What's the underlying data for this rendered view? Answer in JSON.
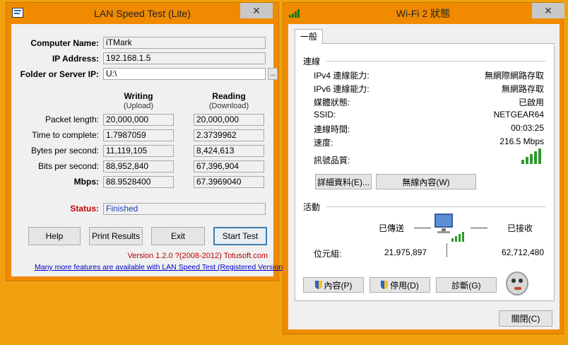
{
  "lan": {
    "title": "LAN Speed Test (Lite)",
    "close": "✕",
    "computer_name_label": "Computer Name:",
    "computer_name": "iTMark",
    "ip_label": "IP Address:",
    "ip": "192.168.1.5",
    "folder_label": "Folder or Server IP:",
    "folder": "U:\\",
    "browse": "...",
    "writing": "Writing",
    "upload": "(Upload)",
    "reading": "Reading",
    "download": "(Download)",
    "rows": [
      {
        "label": "Packet length:",
        "write": "20,000,000",
        "read": "20,000,000"
      },
      {
        "label": "Time to complete:",
        "write": "1.7987059",
        "read": "2.3739962"
      },
      {
        "label": "Bytes per second:",
        "write": "11,119,105",
        "read": "8,424,613"
      },
      {
        "label": "Bits per second:",
        "write": "88,952,840",
        "read": "67,396,904"
      },
      {
        "label": "Mbps:",
        "write": "88.9528400",
        "read": "67.3969040"
      }
    ],
    "status_label": "Status:",
    "status": "Finished",
    "buttons": {
      "help": "Help",
      "print": "Print Results",
      "exit": "Exit",
      "start": "Start Test"
    },
    "version": "Version 1.2.0  ?(2008-2012) Totusoft.com",
    "promo_link": "Many more features are available with LAN Speed Test (Registered Version)",
    "colors": {
      "status_label": "#c00000",
      "status_value": "#1f3fb0",
      "link": "#0000cc"
    }
  },
  "wifi": {
    "title": "Wi-Fi 2 狀態",
    "close": "✕",
    "tab": "一般",
    "connection_group": "連線",
    "rows": [
      {
        "k": "IPv4 連線能力:",
        "v": "無網際網路存取"
      },
      {
        "k": "IPv6 連線能力:",
        "v": "無網路存取"
      },
      {
        "k": "媒體狀態:",
        "v": "已啟用"
      },
      {
        "k": "SSID:",
        "v": "NETGEAR64"
      },
      {
        "k": "連線時間:",
        "v": "00:03:25"
      },
      {
        "k": "速度:",
        "v": "216.5 Mbps"
      }
    ],
    "signal_label": "訊號品質:",
    "details_button": "詳細資料(E)...",
    "wireless_props_button": "無線內容(W)",
    "activity_group": "活動",
    "sent_label": "已傳送",
    "received_label": "已接收",
    "bytes_label": "位元組:",
    "bytes_sent": "21,975,897",
    "bytes_received": "62,712,480",
    "properties_button": "內容(P)",
    "disable_button": "停用(D)",
    "diagnose_button": "診斷(G)",
    "close_button": "關閉(C)"
  }
}
